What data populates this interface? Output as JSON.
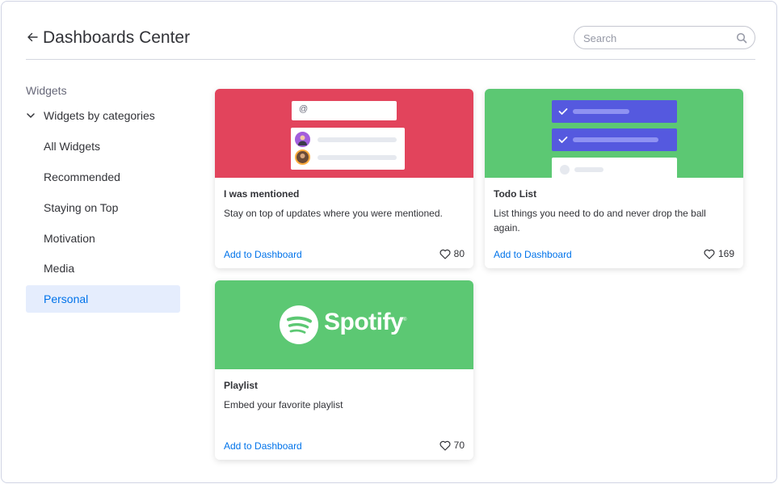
{
  "header": {
    "title": "Dashboards Center",
    "search_placeholder": "Search"
  },
  "sidebar": {
    "heading": "Widgets",
    "category_label": "Widgets by categories",
    "items": [
      {
        "label": "All Widgets",
        "active": false
      },
      {
        "label": "Recommended",
        "active": false
      },
      {
        "label": "Staying on Top",
        "active": false
      },
      {
        "label": "Motivation",
        "active": false
      },
      {
        "label": "Media",
        "active": false
      },
      {
        "label": "Personal",
        "active": true
      }
    ]
  },
  "cards": [
    {
      "title": "I was mentioned",
      "description": "Stay on top of updates where you were mentioned.",
      "action": "Add to Dashboard",
      "likes": "80",
      "banner_color": "#e2445c",
      "mention_symbol": "@"
    },
    {
      "title": "Todo List",
      "description": "List things you need to do and never drop the ball again.",
      "action": "Add to Dashboard",
      "likes": "169",
      "banner_color": "#5cc873"
    },
    {
      "title": "Playlist",
      "description": "Embed your favorite playlist",
      "action": "Add to Dashboard",
      "likes": "70",
      "banner_color": "#5cc873",
      "logo_text": "Spotify",
      "logo_mark": "®"
    }
  ],
  "colors": {
    "accent": "#0073ea",
    "active_bg": "#e5edfd",
    "todo_item": "#5559df"
  },
  "icons": [
    "back-arrow-icon",
    "search-icon",
    "chevron-down-icon",
    "heart-icon",
    "check-icon",
    "spotify-logo-icon"
  ]
}
